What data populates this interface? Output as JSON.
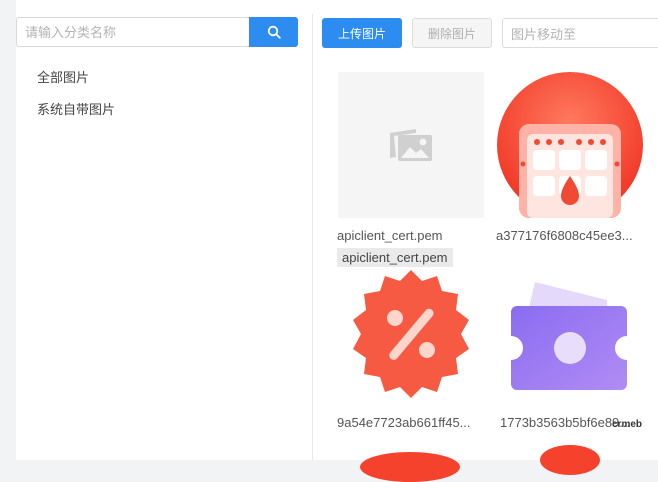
{
  "category_panel": {
    "search": {
      "placeholder": "请输入分类名称",
      "icon": "search-icon"
    },
    "items": [
      {
        "label": "全部图片"
      },
      {
        "label": "系统自带图片"
      }
    ]
  },
  "toolbar": {
    "upload_label": "上传图片",
    "delete_label": "删除图片",
    "move_placeholder": "图片移动至"
  },
  "images": [
    {
      "name": "apiclient_cert.pem",
      "kind": "placeholder",
      "icon": "image-placeholder-icon"
    },
    {
      "name": "a377176f6808c45ee3...",
      "kind": "red-calendar",
      "icon": "calendar-icon"
    },
    {
      "name": "9a54e7723ab661ff45...",
      "kind": "discount-badge",
      "icon": "percent-icon"
    },
    {
      "name": "1773b3563b5bf6e89...",
      "kind": "purple-wallet",
      "icon": "wallet-icon"
    }
  ],
  "tooltip": "apiclient_cert.pem",
  "colors": {
    "primary": "#2d8cf0",
    "red": "#f4422d",
    "purple": "#8a6cf0"
  },
  "watermark": "crmeb"
}
